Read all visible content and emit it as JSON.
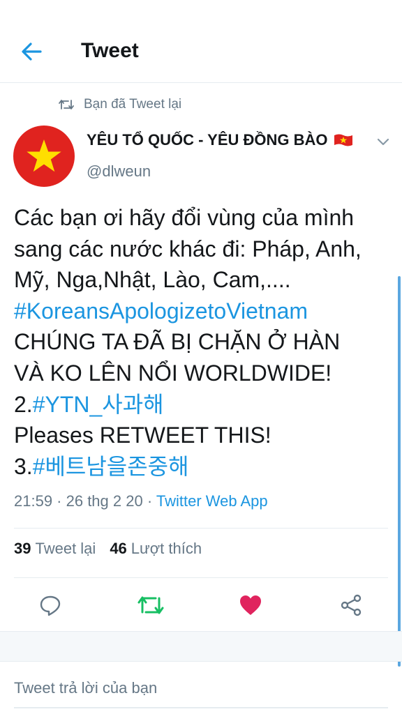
{
  "header": {
    "title": "Tweet"
  },
  "retweet_context": {
    "text": "Bạn đã Tweet lại"
  },
  "author": {
    "name": "YÊU TỔ QUỐC - YÊU ĐỒNG BÀO",
    "handle": "@dlweun",
    "avatar": "vietnam-flag-star"
  },
  "tweet": {
    "lines": [
      {
        "text": "Các bạn ơi hãy đổi vùng của mình"
      },
      {
        "text": "sang các nước khác đi: Pháp, Anh,"
      },
      {
        "text": "Mỹ, Nga,Nhật, Lào, Cam,...."
      },
      {
        "hashtag": "#KoreansApologizetoVietnam"
      },
      {
        "text": "CHÚNG TA ĐÃ BỊ CHẶN Ở HÀN"
      },
      {
        "text": "VÀ KO LÊN NỔI WORLDWIDE!"
      },
      {
        "prefix": "2.",
        "hashtag": "#YTN_사과해"
      },
      {
        "text": "Pleases RETWEET THIS!"
      },
      {
        "prefix": "3.",
        "hashtag": "#베트남을존중해"
      }
    ],
    "timestamp": "21:59 · 26 thg 2 20 · ",
    "source": "Twitter Web App"
  },
  "stats": {
    "retweets_count": "39",
    "retweets_label": "Tweet lại",
    "likes_count": "46",
    "likes_label": "Lượt thích"
  },
  "actions": [
    "reply-icon",
    "retweet-icon",
    "like-icon",
    "share-icon"
  ],
  "colors": {
    "accent": "#1b95e0",
    "retweet_green": "#17bf63",
    "like_pink": "#e0245e",
    "muted": "#657786"
  },
  "reply": {
    "placeholder": "Tweet trả lời của bạn"
  }
}
